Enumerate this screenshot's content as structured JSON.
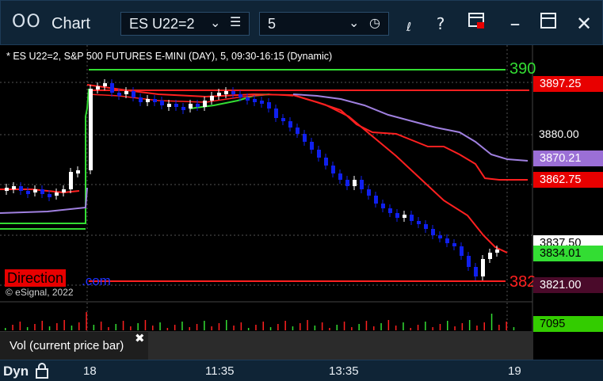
{
  "titlebar": {
    "app_title": "Chart",
    "app_icon": "chart-icon",
    "symbol": "ES U22=2",
    "interval": "5",
    "buttons": [
      "list-icon",
      "clock-icon",
      "draw-icon",
      "help-icon",
      "form-icon",
      "maximize-icon",
      "close-icon"
    ],
    "help_glyph": "?",
    "close_glyph": "✕"
  },
  "chart": {
    "study_label": "* ES U22=2, S&P 500 FUTURES E-MINI (DAY), 5, 09:30-16:15 (Dynamic)",
    "copyright": "© eSignal, 2022",
    "direction_label": "Direction",
    "com_text": ".com",
    "level_top": "390",
    "level_bottom": "382",
    "axis_labels": [
      "3880.00"
    ],
    "price_tags": [
      {
        "value": "3897.25",
        "bg": "#e80000",
        "fg": "#ffffff"
      },
      {
        "value": "3870.21",
        "bg": "#9b6fd6",
        "fg": "#ffffff"
      },
      {
        "value": "3862.75",
        "bg": "#e80000",
        "fg": "#ffffff"
      },
      {
        "value": "3837.50",
        "bg": "#ffffff",
        "fg": "#000000"
      },
      {
        "value": "3834.01",
        "bg": "#33dd33",
        "fg": "#000000"
      },
      {
        "value": "3821.00",
        "bg": "#4a0a2a",
        "fg": "#ffffff"
      }
    ],
    "colors": {
      "up": "#ffffff",
      "down": "#1020ee",
      "ma_red": "#ff2020",
      "ma_purple": "#a080e0",
      "ma_green": "#33dd33"
    }
  },
  "volume": {
    "label": "Vol (current price bar)",
    "close_glyph": "✖",
    "value": "7095",
    "value_bg": "#33cc00"
  },
  "timeaxis": {
    "dyn_label": "Dyn",
    "labels": [
      "18",
      "11:35",
      "13:35",
      "19"
    ]
  }
}
